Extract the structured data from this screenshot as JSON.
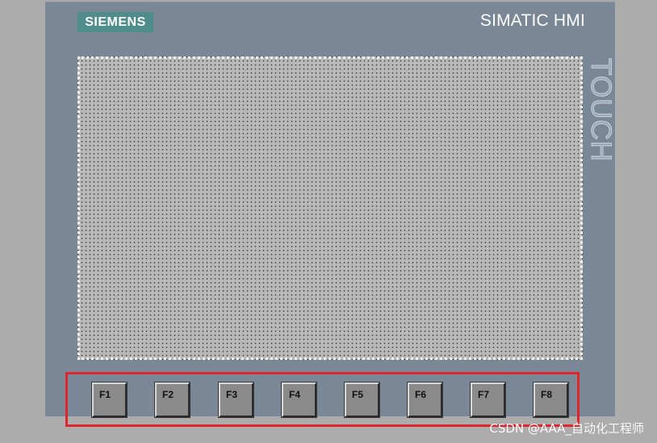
{
  "device": {
    "brand": "SIEMENS",
    "product_title": "SIMATIC HMI",
    "side_label": "TOUCH"
  },
  "function_keys": [
    {
      "label": "F1"
    },
    {
      "label": "F2"
    },
    {
      "label": "F3"
    },
    {
      "label": "F4"
    },
    {
      "label": "F5"
    },
    {
      "label": "F6"
    },
    {
      "label": "F7"
    },
    {
      "label": "F8"
    }
  ],
  "watermark": "CSDN @AAA_自动化工程师",
  "colors": {
    "panel": "#7a8796",
    "logo_bg": "#4f8d8d",
    "screen": "#b8b8b8",
    "highlight_box": "#e0262c",
    "key": "#8a8a8a"
  }
}
